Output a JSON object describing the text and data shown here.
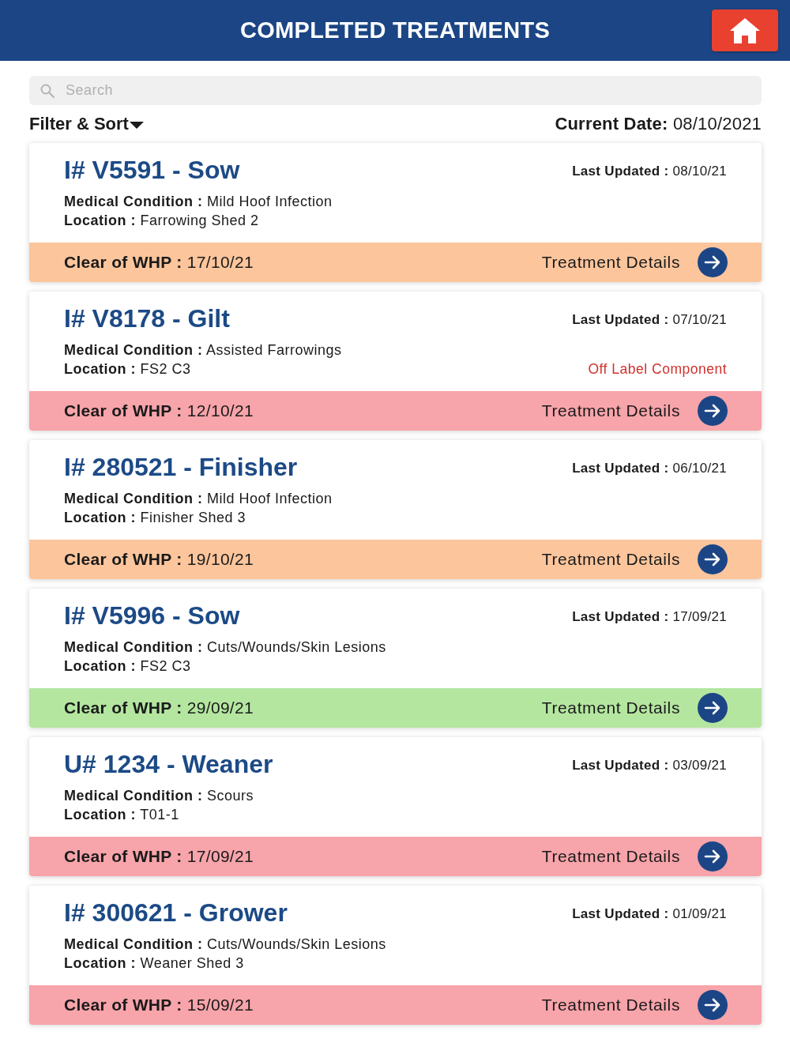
{
  "header": {
    "title": "COMPLETED TREATMENTS"
  },
  "search": {
    "placeholder": "Search"
  },
  "toolbar": {
    "filter_sort": "Filter & Sort",
    "current_date": "**Current Date:** 08/10/2021"
  },
  "treatments": [
    {
      "title": "I# V5591 - Sow",
      "last_updated": "**Last Updated :** 08/10/21",
      "medical_condition": "**Medical Condition :** Mild Hoof Infection",
      "location": "**Location :** Farrowing Shed 2",
      "whp": "**Clear of WHP :** 17/10/21",
      "color": "#fcc59c",
      "details": "Treatment Details"
    },
    {
      "title": "I# V8178 - Gilt",
      "last_updated": "**Last Updated :** 07/10/21",
      "medical_condition": "**Medical Condition :** Assisted Farrowings",
      "location": "**Location :** FS2 C3",
      "warning": "Off Label Component",
      "whp": "**Clear of WHP :** 12/10/21",
      "color": "#f7a4aa",
      "details": "Treatment Details"
    },
    {
      "title": "I# 280521 - Finisher",
      "last_updated": "**Last Updated :** 06/10/21",
      "medical_condition": "**Medical Condition :** Mild Hoof Infection",
      "location": "**Location :** Finisher Shed 3",
      "whp": "**Clear of WHP :** 19/10/21",
      "color": "#fcc59c",
      "details": "Treatment Details"
    },
    {
      "title": "I# V5996 - Sow",
      "last_updated": "**Last Updated :** 17/09/21",
      "medical_condition": "**Medical Condition :** Cuts/Wounds/Skin Lesions",
      "location": "**Location :** FS2 C3",
      "whp": "**Clear of WHP :** 29/09/21",
      "color": "#b4e6a0",
      "details": "Treatment Details"
    },
    {
      "title": "U# 1234 - Weaner",
      "last_updated": "**Last Updated :** 03/09/21",
      "medical_condition": "**Medical Condition :** Scours",
      "location": "**Location :** T01-1",
      "whp": "**Clear of WHP :** 17/09/21",
      "color": "#f7a4aa",
      "details": "Treatment Details"
    },
    {
      "title": "I# 300621 - Grower",
      "last_updated": "**Last Updated :** 01/09/21",
      "medical_condition": "**Medical Condition :** Cuts/Wounds/Skin Lesions",
      "location": "**Location :** Weaner Shed 3",
      "whp": "**Clear of WHP :** 15/09/21",
      "color": "#f7a4aa",
      "details": "Treatment Details"
    }
  ]
}
